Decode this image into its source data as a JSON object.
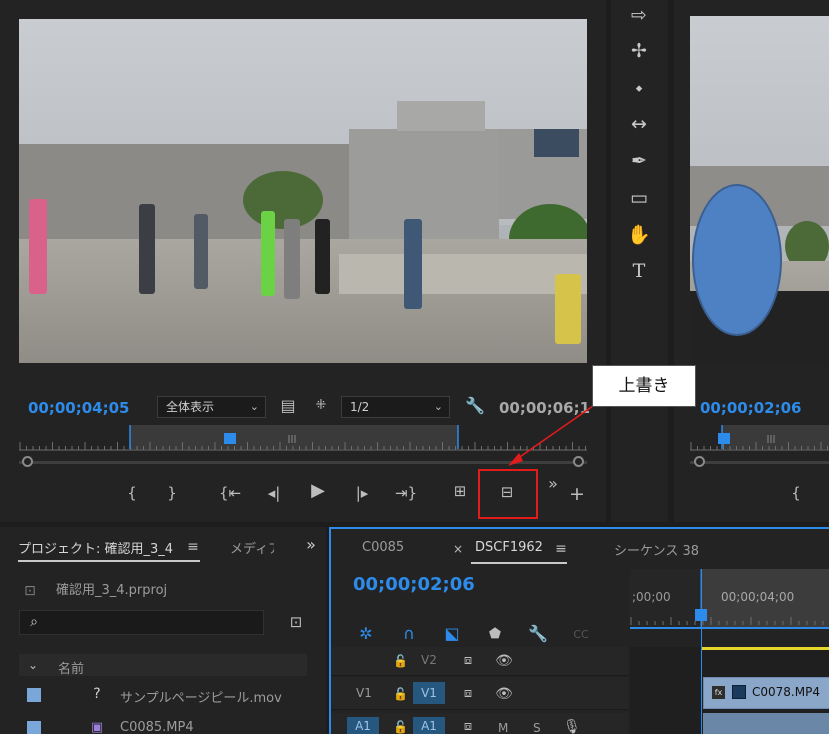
{
  "source_monitor": {
    "timecode_current": "00;00;04;05",
    "timecode_duration": "00;00;06;1",
    "zoom_value": "全体表示",
    "resolution_value": "1/2"
  },
  "program_monitor": {
    "timecode_current": "00;00;02;06"
  },
  "callout": {
    "label": "上書き"
  },
  "project_panel": {
    "tab_project": "プロジェクト: 確認用_3_4",
    "tab_media": "メディア",
    "file_name": "確認用_3_4.prproj",
    "column_name": "名前",
    "items": [
      {
        "name": "サンプルページピール.mov"
      },
      {
        "name": "C0085.MP4"
      }
    ]
  },
  "timeline_panel": {
    "tabs": [
      {
        "label": "C0085"
      },
      {
        "label": "DSCF1962"
      },
      {
        "label": "シーケンス 38"
      }
    ],
    "timecode": "00;00;02;06",
    "ruler_start": ";00;00",
    "ruler_mark": "00;00;04;00",
    "tracks": {
      "v2": "V2",
      "v1_source": "V1",
      "v1_target": "V1",
      "a1_source": "A1",
      "a1_target": "A1",
      "mute": "M",
      "solo": "S"
    },
    "clip_name": "C0078.MP4"
  },
  "icons": {
    "tools": [
      "track-select-forward-icon",
      "ripple-edit-icon",
      "razor-icon",
      "slip-icon",
      "pen-icon",
      "rectangle-icon",
      "hand-icon",
      "type-icon"
    ],
    "accent": "#2d8ceb",
    "highlight": "#e21b1b"
  }
}
